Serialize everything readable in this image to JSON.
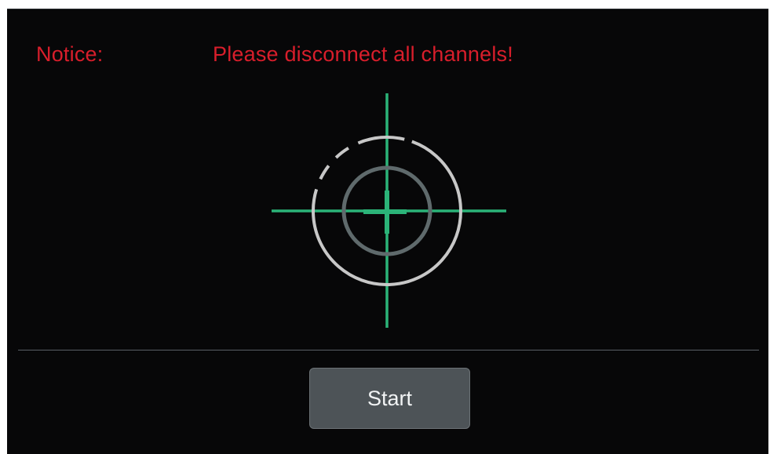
{
  "notice": {
    "label": "Notice:",
    "message": "Please disconnect all channels!"
  },
  "target_icon": "calibration-crosshair-icon",
  "buttons": {
    "start_label": "Start"
  },
  "colors": {
    "background": "#070708",
    "notice_text": "#d81e2b",
    "crosshair": "#2bb378",
    "outer_ring": "#c7c7c7",
    "inner_ring": "#5f6a6c",
    "button_bg": "#4d5357",
    "button_text": "#f1f3f4"
  }
}
